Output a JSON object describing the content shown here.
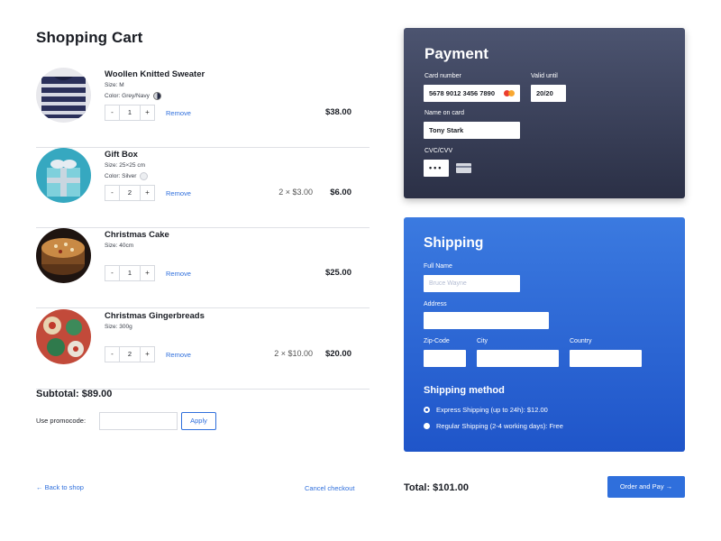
{
  "cart": {
    "title": "Shopping Cart",
    "items": [
      {
        "name": "Woollen Knitted Sweater",
        "size": "Size: M",
        "color_label": "Color: Grey/Navy",
        "quantity": "1",
        "remove": "Remove",
        "unit_calc": "",
        "total": "$38.00"
      },
      {
        "name": "Gift Box",
        "size": "Size: 25×25 cm",
        "color_label": "Color: Silver",
        "quantity": "2",
        "remove": "Remove",
        "unit_calc": "2 × $3.00",
        "total": "$6.00"
      },
      {
        "name": "Christmas Cake",
        "size": "Size: 40cm",
        "color_label": "",
        "quantity": "1",
        "remove": "Remove",
        "unit_calc": "",
        "total": "$25.00"
      },
      {
        "name": "Christmas Gingerbreads",
        "size": "Size: 300g",
        "color_label": "",
        "quantity": "2",
        "remove": "Remove",
        "unit_calc": "2 × $10.00",
        "total": "$20.00"
      }
    ],
    "stepper": {
      "minus": "-",
      "plus": "+"
    },
    "subtotal": "Subtotal: $89.00",
    "promo_label": "Use promocode:",
    "promo_value": "",
    "apply": "Apply",
    "back_link": "← Back to shop",
    "cancel_link": "Cancel checkout"
  },
  "payment": {
    "title": "Payment",
    "card_number_label": "Card number",
    "card_number": "5678 9012 3456 7890",
    "valid_until_label": "Valid until",
    "valid_until": "20/20",
    "name_label": "Name on card",
    "name": "Tony Stark",
    "cvc_label": "CVC/CVV",
    "cvc": "•••"
  },
  "shipping": {
    "title": "Shipping",
    "full_name_label": "Full Name",
    "full_name_placeholder": "Bruce Wayne",
    "address_label": "Address",
    "zip_label": "Zip-Code",
    "city_label": "City",
    "country_label": "Country",
    "method_title": "Shipping method",
    "methods": [
      {
        "label": "Express Shipping (up to 24h): $12.00",
        "checked": true
      },
      {
        "label": "Regular Shipping (2-4 working days): Free",
        "checked": false
      }
    ]
  },
  "footer": {
    "total": "Total: $101.00",
    "order_button": "Order and Pay →"
  },
  "colors": {
    "accent": "#2f6fdc",
    "payment_bg": "#3a4058",
    "shipping_bg": "#2a66d6"
  }
}
